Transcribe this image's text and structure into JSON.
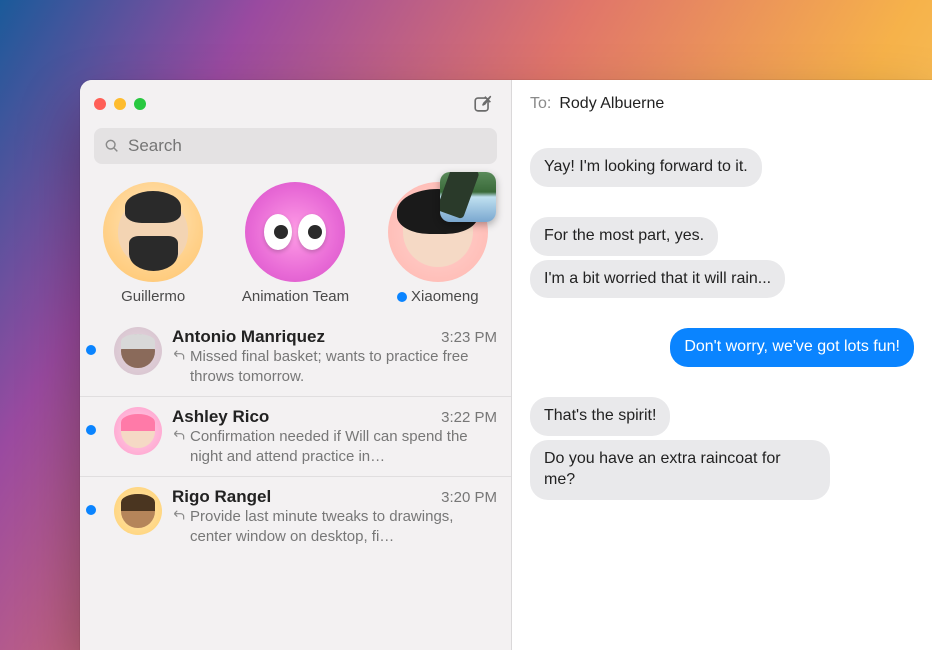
{
  "search": {
    "placeholder": "Search"
  },
  "to": {
    "label": "To:",
    "value": "Rody Albuerne"
  },
  "pins": [
    {
      "name": "Guillermo",
      "unread": false
    },
    {
      "name": "Animation Team",
      "unread": false
    },
    {
      "name": "Xiaomeng",
      "unread": true
    }
  ],
  "conversations": [
    {
      "name": "Antonio Manriquez",
      "time": "3:23 PM",
      "preview": "Missed final basket; wants to practice free throws tomorrow.",
      "unread": true
    },
    {
      "name": "Ashley Rico",
      "time": "3:22 PM",
      "preview": "Confirmation needed if Will can spend the night and attend practice in…",
      "unread": true
    },
    {
      "name": "Rigo Rangel",
      "time": "3:20 PM",
      "preview": "Provide last minute tweaks to drawings, center window on desktop, fi…",
      "unread": true
    }
  ],
  "messages": {
    "g1": [
      {
        "dir": "in",
        "text": "Yay! I'm looking forward to it."
      }
    ],
    "g2": [
      {
        "dir": "in",
        "text": "For the most part, yes."
      },
      {
        "dir": "in",
        "text": "I'm a bit worried that it will rain..."
      }
    ],
    "g3": [
      {
        "dir": "out",
        "text": "Don't worry, we've got lots fun!"
      }
    ],
    "g4": [
      {
        "dir": "in",
        "text": "That's the spirit!"
      },
      {
        "dir": "in",
        "text": "Do you have an extra raincoat for me?"
      }
    ]
  }
}
